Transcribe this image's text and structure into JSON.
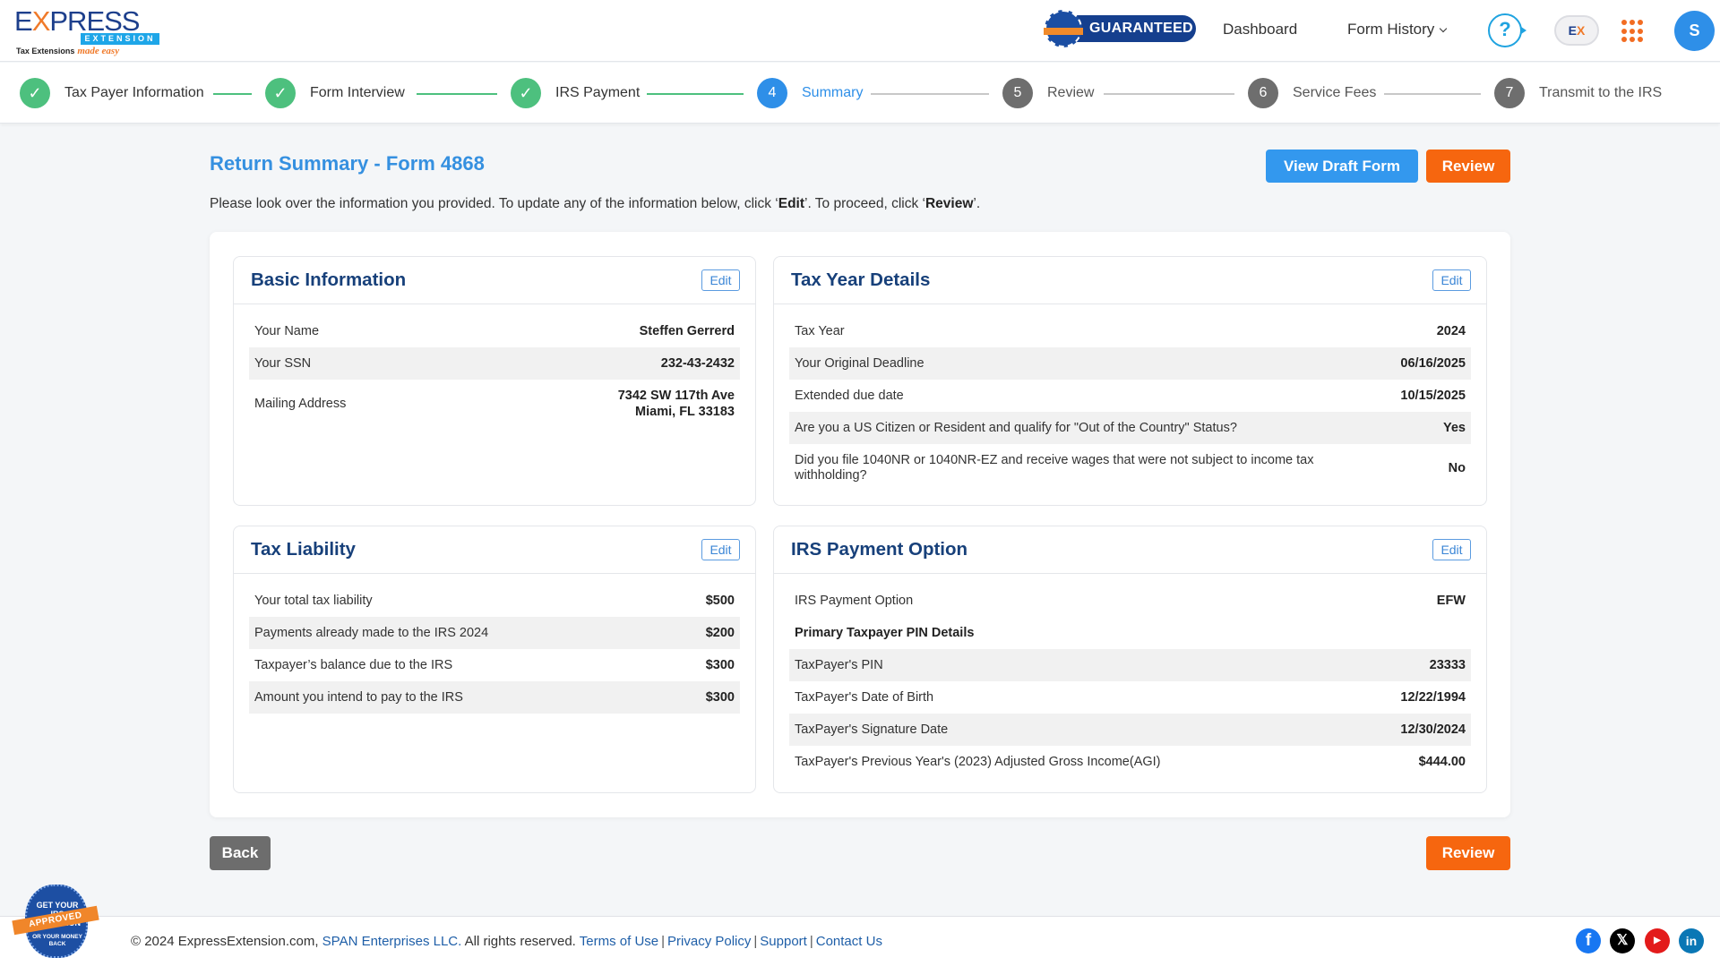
{
  "header": {
    "logo": {
      "word_pre": "E",
      "word_x": "X",
      "word_post": "PRESS",
      "band": "EXTENSION",
      "tagline": "Tax Extensions",
      "tagline_script": "made easy"
    },
    "guaranteed_badge": "GUARANTEED",
    "nav": {
      "dashboard": "Dashboard",
      "form_history": "Form History"
    },
    "help_icon": "?",
    "ex_icon_pre": "E",
    "ex_icon_x": "X",
    "avatar_initial": "S"
  },
  "stepper": {
    "steps": [
      {
        "num": "✓",
        "label": "Tax Payer Information",
        "state": "done"
      },
      {
        "num": "✓",
        "label": "Form Interview",
        "state": "done"
      },
      {
        "num": "✓",
        "label": "IRS Payment",
        "state": "done"
      },
      {
        "num": "4",
        "label": "Summary",
        "state": "active"
      },
      {
        "num": "5",
        "label": "Review",
        "state": "todo"
      },
      {
        "num": "6",
        "label": "Service Fees",
        "state": "todo"
      },
      {
        "num": "7",
        "label": "Transmit to the IRS",
        "state": "todo"
      }
    ]
  },
  "page": {
    "title": "Return Summary - Form 4868",
    "desc_1": "Please look over the information you provided. To update any of the information below, click ‘",
    "desc_edit": "Edit",
    "desc_2": "’. To proceed, click ‘",
    "desc_review": "Review",
    "desc_3": "’.",
    "view_draft_label": "View Draft Form",
    "review_label": "Review",
    "back_label": "Back"
  },
  "cards": {
    "edit_label": "Edit",
    "basic": {
      "title": "Basic Information",
      "rows": [
        {
          "k": "Your Name",
          "v": "Steffen Gerrerd"
        },
        {
          "k": "Your SSN",
          "v": "232-43-2432"
        },
        {
          "k": "Mailing Address",
          "v": "7342 SW 117th Ave",
          "v2": "Miami, FL 33183"
        }
      ]
    },
    "tax_year": {
      "title": "Tax Year Details",
      "rows": [
        {
          "k": "Tax Year",
          "v": "2024"
        },
        {
          "k": "Your Original Deadline",
          "v": "06/16/2025"
        },
        {
          "k": "Extended due date",
          "v": "10/15/2025"
        },
        {
          "k": "Are you a US Citizen or Resident and qualify for \"Out of the Country\" Status?",
          "v": "Yes"
        },
        {
          "k": "Did you file 1040NR or 1040NR-EZ and receive wages that were not subject to income tax withholding?",
          "v": "No"
        }
      ]
    },
    "liability": {
      "title": "Tax Liability",
      "rows": [
        {
          "k": "Your total tax liability",
          "v": "$500"
        },
        {
          "k": "Payments already made to the IRS 2024",
          "v": "$200"
        },
        {
          "k": "Taxpayer’s balance due to the IRS",
          "v": "$300"
        },
        {
          "k": "Amount you intend to pay to the IRS",
          "v": "$300"
        }
      ]
    },
    "payment": {
      "title": "IRS Payment Option",
      "rows": [
        {
          "k": "IRS Payment Option",
          "v": "EFW"
        },
        {
          "k": "Primary Taxpayer PIN Details",
          "v": ""
        },
        {
          "k": "TaxPayer's PIN",
          "v": "23333"
        },
        {
          "k": "TaxPayer's Date of Birth",
          "v": "12/22/1994"
        },
        {
          "k": "TaxPayer's Signature Date",
          "v": "12/30/2024"
        },
        {
          "k": "TaxPayer's Previous Year's (2023) Adjusted Gross Income(AGI)",
          "v": "$444.00"
        }
      ]
    }
  },
  "footer": {
    "copyright": "© 2024 ExpressExtension.com,",
    "company": "SPAN Enterprises LLC.",
    "rights": "All rights reserved.",
    "links": [
      "Terms of Use",
      "Privacy Policy",
      "Support",
      "Contact Us"
    ],
    "seal": {
      "top": "GET YOUR IRS EXTENSION",
      "ribbon": "APPROVED",
      "bottom": "OR YOUR MONEY BACK"
    },
    "social": {
      "facebook": "f",
      "x": "𝕏",
      "youtube": "▶",
      "linkedin": "in"
    }
  },
  "colors": {
    "primary": "#3398ee",
    "accent_orange": "#f6660f",
    "done_green": "#4dc07e",
    "title_navy": "#17407a"
  }
}
